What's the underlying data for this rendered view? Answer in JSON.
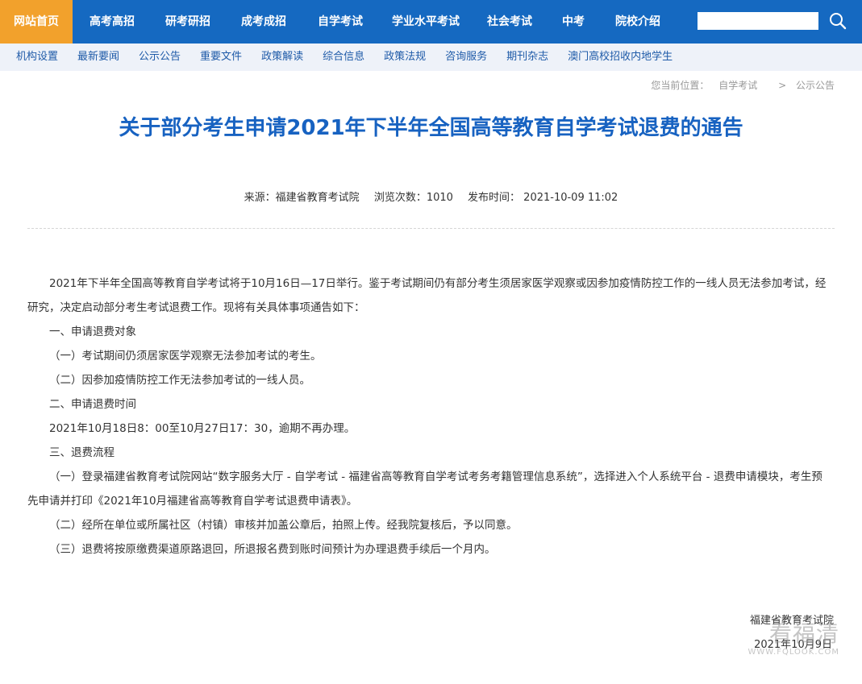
{
  "topnav": {
    "items": [
      "网站首页",
      "高考高招",
      "研考研招",
      "成考成招",
      "自学考试",
      "学业水平考试",
      "社会考试",
      "中考",
      "院校介绍"
    ],
    "search_placeholder": ""
  },
  "subnav": {
    "items": [
      "机构设置",
      "最新要闻",
      "公示公告",
      "重要文件",
      "政策解读",
      "综合信息",
      "政策法规",
      "咨询服务",
      "期刊杂志",
      "澳门高校招收内地学生"
    ]
  },
  "breadcrumb": {
    "label": "您当前位置：",
    "path1": "自学考试",
    "sep": ">",
    "path2": "公示公告"
  },
  "article": {
    "title": "关于部分考生申请2021年下半年全国高等教育自学考试退费的通告",
    "source": "来源：福建省教育考试院",
    "views": "浏览次数：1010",
    "published": "发布时间： 2021-10-09 11:02",
    "paragraphs": [
      "2021年下半年全国高等教育自学考试将于10月16日—17日举行。鉴于考试期间仍有部分考生须居家医学观察或因参加疫情防控工作的一线人员无法参加考试，经研究，决定启动部分考生考试退费工作。现将有关具体事项通告如下：",
      "一、申请退费对象",
      "（一）考试期间仍须居家医学观察无法参加考试的考生。",
      "（二）因参加疫情防控工作无法参加考试的一线人员。",
      "二、申请退费时间",
      "2021年10月18日8：00至10月27日17：30，逾期不再办理。",
      "三、退费流程",
      "（一）登录福建省教育考试院网站“数字服务大厅 - 自学考试 - 福建省高等教育自学考试考务考籍管理信息系统”，选择进入个人系统平台 - 退费申请模块，考生预先申请并打印《2021年10月福建省高等教育自学考试退费申请表》。",
      "（二）经所在单位或所属社区（村镇）审核并加盖公章后，拍照上传。经我院复核后，予以同意。",
      "（三）退费将按原缴费渠道原路退回，所退报名费到账时间预计为办理退费手续后一个月内。"
    ],
    "signature_org": "福建省教育考试院",
    "signature_date": "2021年10月9日"
  },
  "watermark": {
    "cn": "看福清",
    "en": "WWW.FQLOOK.COM"
  },
  "colors": {
    "nav_bg": "#1569c1",
    "nav_active": "#f2a12c",
    "subnav_bg": "#eef2f9",
    "title": "#1762c1"
  }
}
